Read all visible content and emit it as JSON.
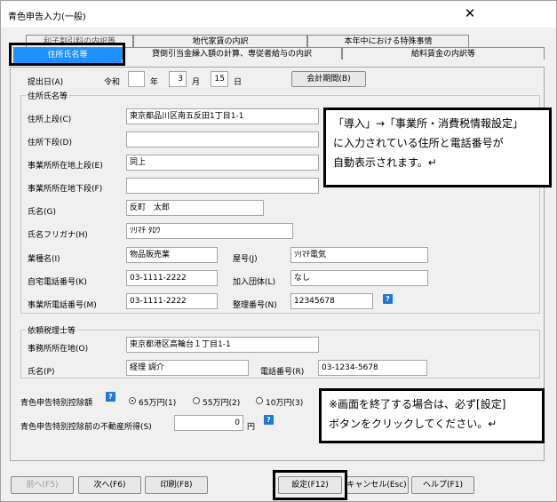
{
  "window": {
    "title": "青色申告入力(一般)",
    "close_glyph": "✕"
  },
  "tabs_row1": [
    "利子割引料の内訳等",
    "地代家賃の内訳",
    "本年中における特殊事情"
  ],
  "tabs_row2": [
    "住所氏名等",
    "貸倒引当金繰入額の計算、専従者給与の内訳",
    "給料賃金の内訳等"
  ],
  "filing_date": {
    "label": "提出日(A)",
    "era": "令和",
    "year": "",
    "year_unit": "年",
    "month": "3",
    "month_unit": "月",
    "day": "15",
    "day_unit": "日"
  },
  "fiscal_button": "会計期間(B)",
  "taxpayer": {
    "group_label": "住所氏名等",
    "address_upper": {
      "label": "住所上段(C)",
      "value": "東京都品川区南五反田1丁目1-1"
    },
    "address_lower": {
      "label": "住所下段(D)",
      "value": ""
    },
    "office_upper": {
      "label": "事業所所在地上段(E)",
      "value": "同上"
    },
    "office_lower": {
      "label": "事業所所在地下段(F)",
      "value": ""
    },
    "name": {
      "label": "氏名(G)",
      "value": "反町　太郎"
    },
    "furigana": {
      "label": "氏名フリガナ(H)",
      "value": "ｿﾘﾏﾁ ﾀﾛｳ"
    },
    "business": {
      "label": "業種名(I)",
      "value": "物品販売業"
    },
    "shop_name": {
      "label": "屋号(J)",
      "value": "ｿﾘﾏﾁ電気"
    },
    "home_phone": {
      "label": "自宅電話番号(K)",
      "value": "03-1111-2222"
    },
    "association": {
      "label": "加入団体(L)",
      "value": "なし"
    },
    "office_phone": {
      "label": "事業所電話番号(M)",
      "value": "03-1111-2222"
    },
    "ref_number": {
      "label": "整理番号(N)",
      "value": "12345678"
    }
  },
  "accountant": {
    "group_label": "依頼税理士等",
    "office": {
      "label": "事務所所在地(O)",
      "value": "東京都港区高輪台１丁目1-1"
    },
    "name": {
      "label": "氏名(P)",
      "value": "経理 調介"
    },
    "phone": {
      "label": "電話番号(R)",
      "value": "03-1234-5678"
    }
  },
  "deduction": {
    "label": "青色申告特別控除額",
    "options": [
      "65万円(1)",
      "55万円(2)",
      "10万円(3)"
    ],
    "selected_index": 0
  },
  "real_estate": {
    "label": "青色申告特別控除前の不動産所得(S)",
    "value": "0",
    "unit": "円"
  },
  "help_glyph": "?",
  "callout_top": [
    "「導入」→「事業所・消費税情報設定」",
    "に入力されている住所と電話番号が",
    "自動表示されます。↵"
  ],
  "callout_bottom": [
    "※画面を終了する場合は、必ず[設定]",
    "ボタンをクリックしてください。↵"
  ],
  "buttons": {
    "prev": "前へ(F5)",
    "next": "次へ(F6)",
    "print": "印刷(F8)",
    "settings": "設定(F12)",
    "cancel": "キャンセル(Esc)",
    "help": "ヘルプ(F1)"
  }
}
